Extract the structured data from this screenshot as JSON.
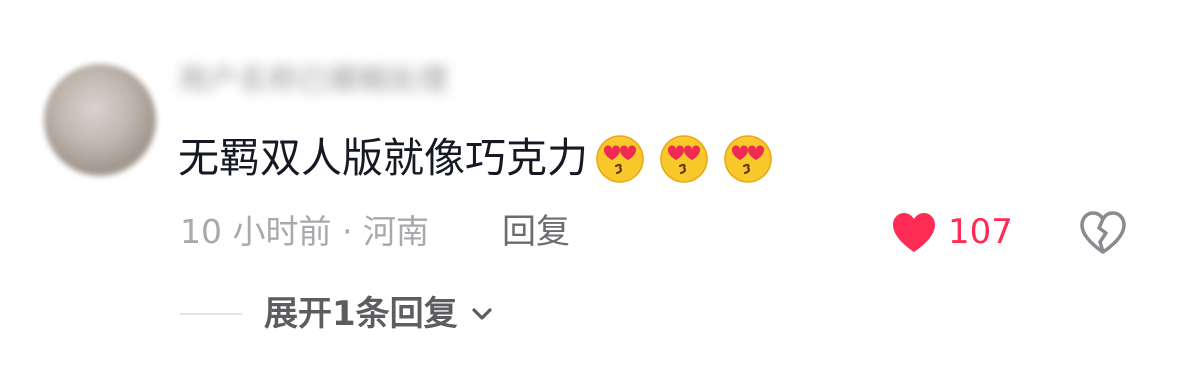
{
  "comment": {
    "username": "用户名称已模糊处理",
    "text": "无羁双人版就像巧克力",
    "emojis": [
      "heart-eyes-kiss-emoji",
      "heart-eyes-kiss-emoji",
      "heart-eyes-kiss-emoji"
    ],
    "meta": "10 小时前 · 河南",
    "reply_label": "回复",
    "like_count": "107",
    "expand_label": "展开1条回复"
  },
  "colors": {
    "like": "#fe2c55",
    "text": "#161823",
    "secondary": "#a8a8ad"
  }
}
